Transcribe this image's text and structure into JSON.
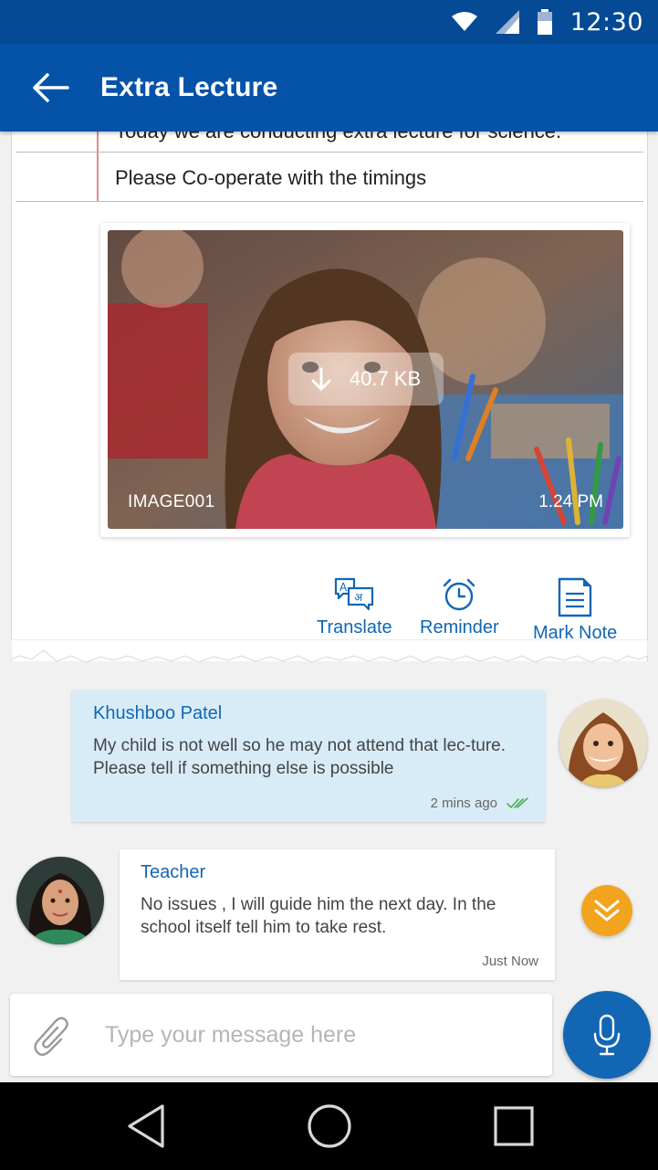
{
  "status_bar": {
    "time": "12:30",
    "icons": [
      "wifi-icon",
      "signal-icon",
      "battery-icon"
    ]
  },
  "app_bar": {
    "title": "Extra Lecture",
    "back_icon": "arrow-left-icon"
  },
  "note": {
    "lines": [
      "Today we are conducting extra lecture for science.",
      "Please Co-operate with the timings"
    ],
    "attachment": {
      "size": "40.7 KB",
      "name": "IMAGE001",
      "time": "1.24 PM"
    },
    "actions": [
      {
        "label": "Translate",
        "icon": "translate-icon"
      },
      {
        "label": "Reminder",
        "icon": "alarm-clock-icon"
      },
      {
        "label": "Mark Note",
        "icon": "note-icon"
      }
    ]
  },
  "messages": [
    {
      "sender": "Khushboo Patel",
      "text": "My child is not well so he may not attend that lec-ture. Please tell if something else is possible",
      "time": "2 mins ago",
      "status_icon": "double-check-icon"
    },
    {
      "sender": "Teacher",
      "text": "No issues , I will guide him the next day. In the school itself tell him to take rest.",
      "time": "Just Now"
    }
  ],
  "composer": {
    "placeholder": "Type your message here",
    "value": ""
  },
  "colors": {
    "primary": "#0553a8",
    "status": "#054a94",
    "accent": "#f2a41e",
    "incoming_bubble": "#d8ecf8",
    "link": "#1266b3"
  }
}
